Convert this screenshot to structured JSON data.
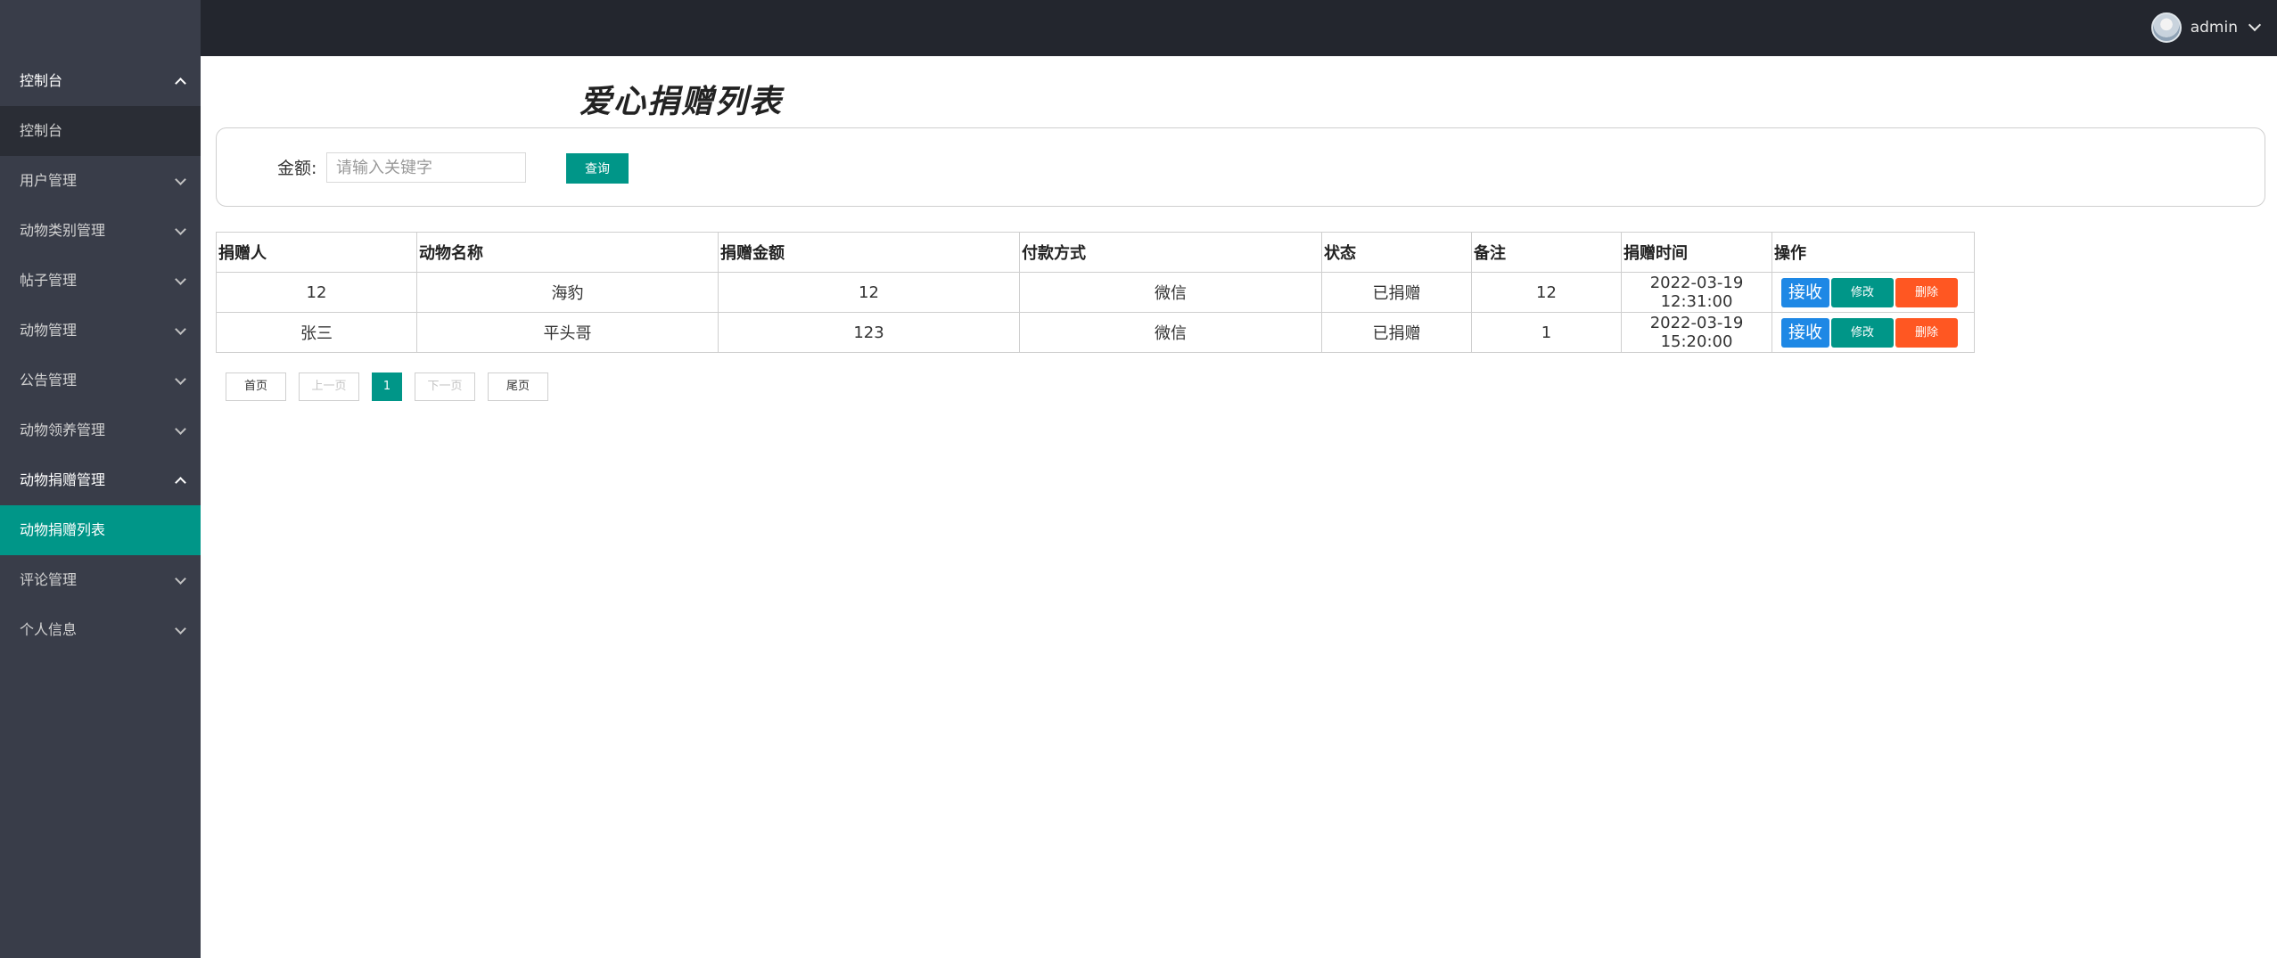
{
  "header": {
    "user_name": "admin",
    "avatar_icon": "user-avatar-icon"
  },
  "sidebar": {
    "items": [
      {
        "label": "控制台",
        "expanded": true,
        "children": [
          {
            "label": "控制台"
          }
        ]
      },
      {
        "label": "用户管理",
        "expanded": false
      },
      {
        "label": "动物类别管理",
        "expanded": false
      },
      {
        "label": "帖子管理",
        "expanded": false
      },
      {
        "label": "动物管理",
        "expanded": false
      },
      {
        "label": "公告管理",
        "expanded": false
      },
      {
        "label": "动物领养管理",
        "expanded": false
      },
      {
        "label": "动物捐赠管理",
        "expanded": true,
        "children": [
          {
            "label": "动物捐赠列表",
            "active": true
          }
        ]
      },
      {
        "label": "评论管理",
        "expanded": false
      },
      {
        "label": "个人信息",
        "expanded": false
      }
    ]
  },
  "main": {
    "title": "爱心捐赠列表",
    "search": {
      "label": "金额:",
      "placeholder": "请输入关键字",
      "button_label": "查询"
    },
    "table": {
      "columns": [
        "捐赠人",
        "动物名称",
        "捐赠金额",
        "付款方式",
        "状态",
        "备注",
        "捐赠时间",
        "操作"
      ],
      "rows": [
        {
          "donor": "12",
          "animal": "海豹",
          "amount": "12",
          "payment": "微信",
          "status": "已捐赠",
          "note": "12",
          "time": "2022-03-19 12:31:00"
        },
        {
          "donor": "张三",
          "animal": "平头哥",
          "amount": "123",
          "payment": "微信",
          "status": "已捐赠",
          "note": "1",
          "time": "2022-03-19 15:20:00"
        }
      ],
      "actions": {
        "accept": "接收",
        "edit": "修改",
        "delete": "删除"
      }
    },
    "pagination": {
      "first": "首页",
      "prev": "上一页",
      "current": "1",
      "next": "下一页",
      "last": "尾页"
    }
  },
  "colors": {
    "header_bg": "#23262e",
    "sidebar_bg": "#393d49",
    "accent": "#009688",
    "accept_btn": "#1e88e5",
    "delete_btn": "#ff5722"
  }
}
